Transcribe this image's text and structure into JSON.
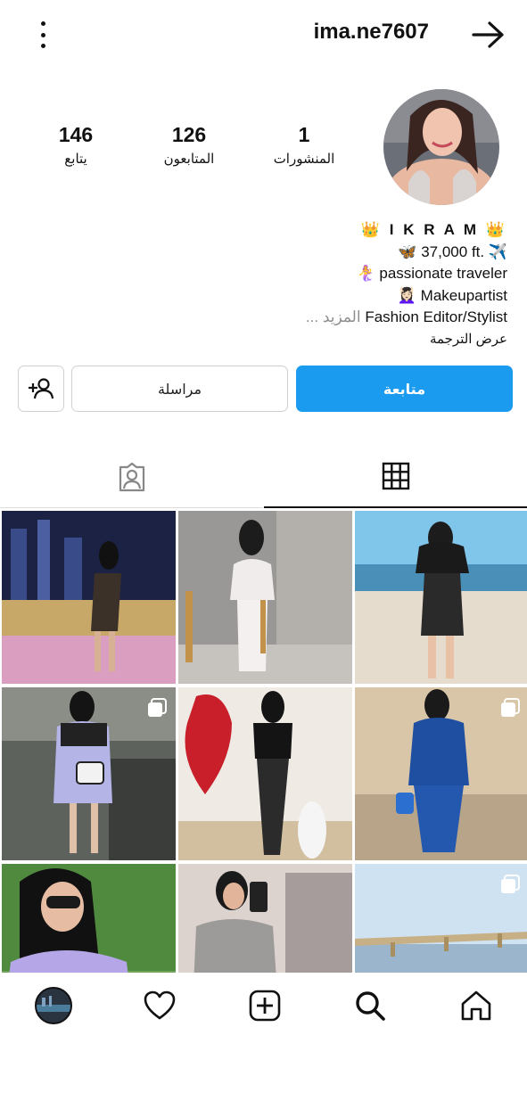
{
  "header": {
    "username": "ima.ne7607",
    "menu_icon": "kebab-menu-icon",
    "back_icon": "arrow-right-icon"
  },
  "profile": {
    "stats": {
      "posts": {
        "value": "1",
        "label": "المنشورات"
      },
      "followers": {
        "value": "126",
        "label": "المتابعون"
      },
      "following": {
        "value": "146",
        "label": "يتابع"
      }
    },
    "bio": {
      "name": "👑 I K R A M 👑",
      "line1": "🦋 37,000 ft. ✈️",
      "line2": "🧜‍♀️ passionate traveler",
      "line3": "💆🏻‍♀️ Makeupartist",
      "line4": "Fashion Editor/Stylist",
      "more": "... المزيد",
      "translate": "عرض الترجمة"
    }
  },
  "actions": {
    "follow_label": "متابعة",
    "message_label": "مراسلة",
    "add_user_icon": "add-user-icon"
  },
  "tabs": [
    {
      "name": "grid",
      "icon": "grid-icon",
      "active": true
    },
    {
      "name": "tagged",
      "icon": "tagged-user-icon",
      "active": false
    }
  ],
  "colors": {
    "accent": "#1a9bf0",
    "text": "#111111",
    "muted": "#8e8e8e",
    "border": "#d0d0d0"
  },
  "posts": [
    {
      "scene": "woman in black top and leather skirt at beach",
      "multi": false
    },
    {
      "scene": "woman in white outfit by pillars",
      "multi": false
    },
    {
      "scene": "woman in animal print dress on night balcony",
      "multi": false
    },
    {
      "scene": "woman in blue leather dress",
      "multi": true
    },
    {
      "scene": "woman in black top by red rose heart",
      "multi": false
    },
    {
      "scene": "woman in lavender dress with handbag",
      "multi": true
    },
    {
      "scene": "bridge over water",
      "multi": true
    },
    {
      "scene": "woman taking mirror selfie",
      "multi": false
    },
    {
      "scene": "woman with sunglasses in purple top",
      "multi": false
    }
  ],
  "bottom_nav": [
    {
      "name": "home",
      "icon": "home-icon"
    },
    {
      "name": "search",
      "icon": "search-icon"
    },
    {
      "name": "create",
      "icon": "plus-square-icon"
    },
    {
      "name": "activity",
      "icon": "heart-icon"
    },
    {
      "name": "profile",
      "icon": "profile-avatar"
    }
  ]
}
